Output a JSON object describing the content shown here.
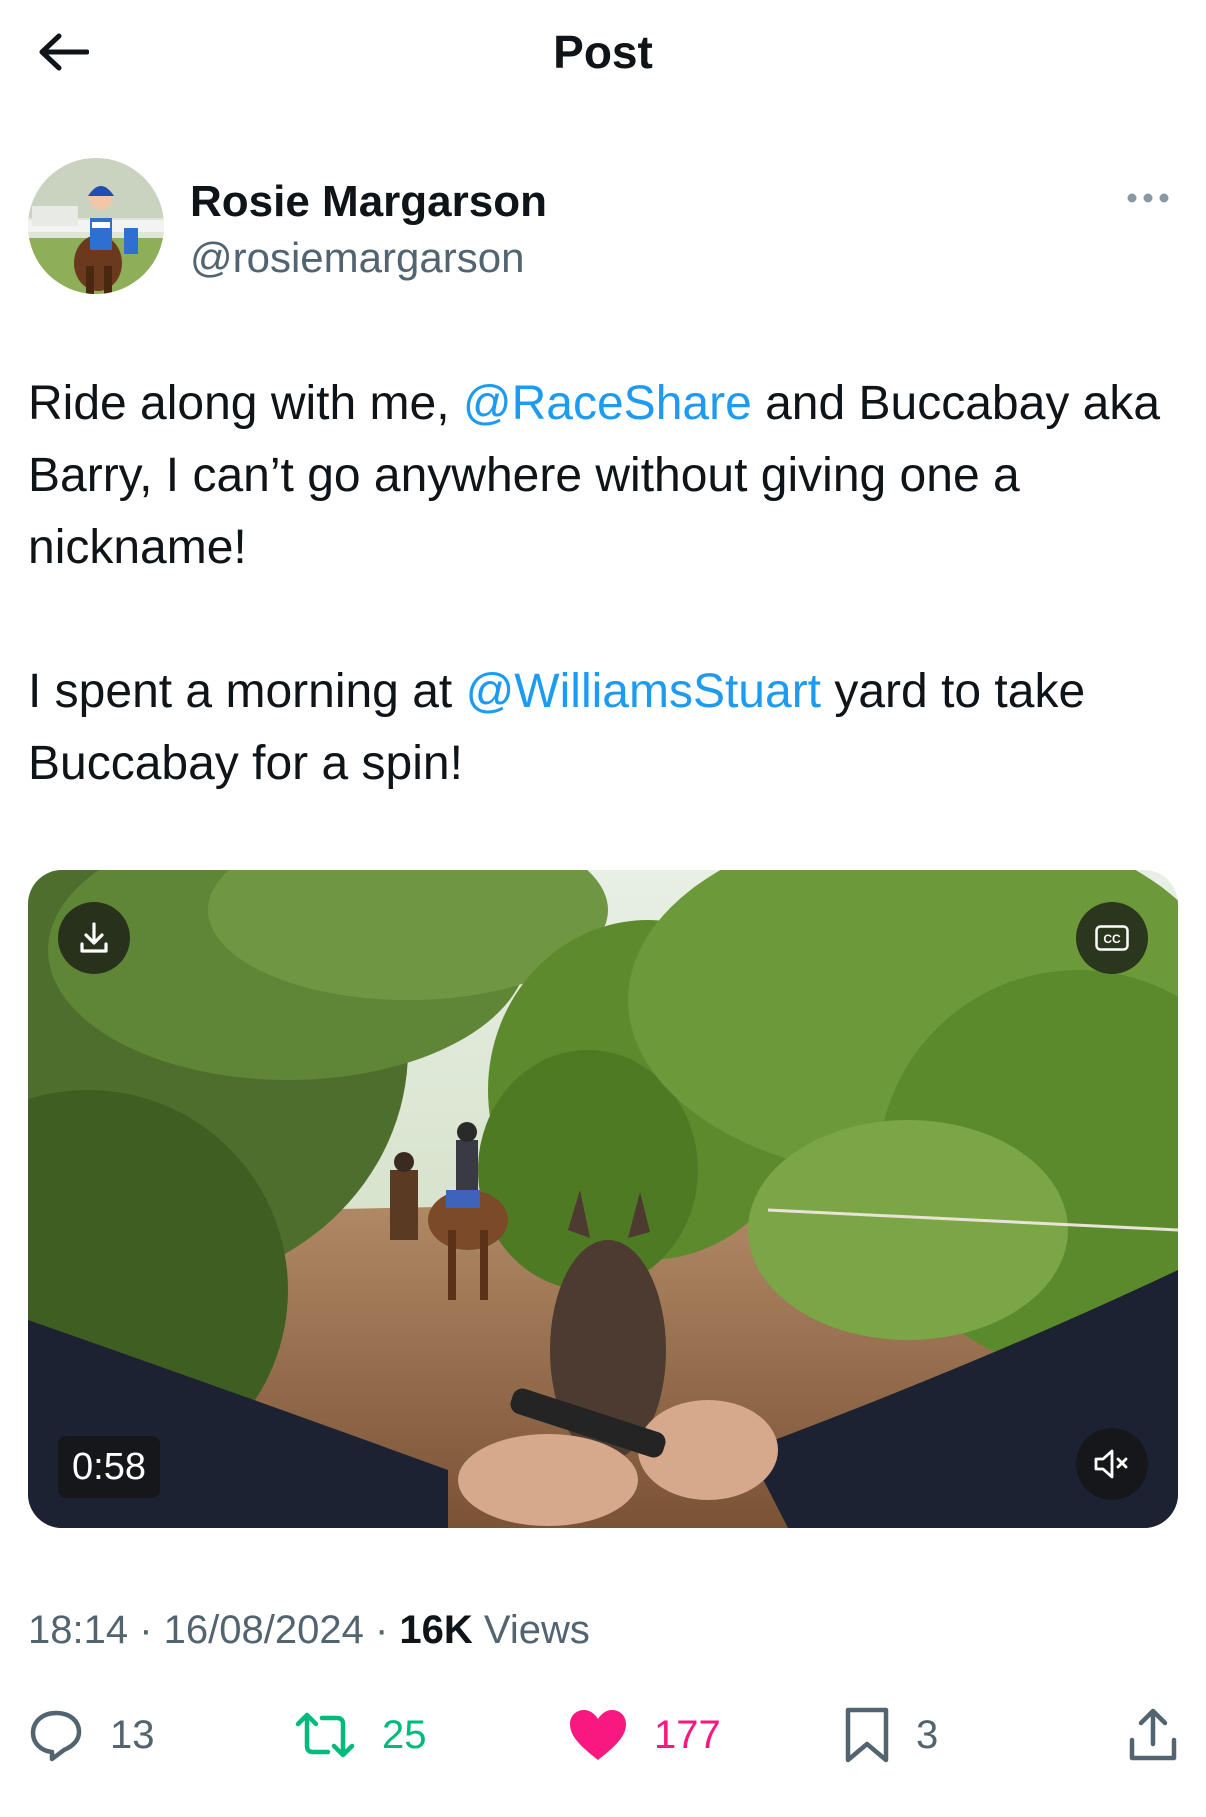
{
  "header": {
    "title": "Post",
    "back_icon": "arrow-left-icon"
  },
  "author": {
    "display_name": "Rosie Margarson",
    "handle": "@rosiemargarson",
    "more_icon": "more-horizontal-icon"
  },
  "tweet": {
    "paragraph1": {
      "part1": "Ride along with me, ",
      "mention1": "@RaceShare",
      "part2": " and Buccabay aka Barry, I can’t go anywhere without giving one a nickname!"
    },
    "paragraph2": {
      "part1": "I spent a morning at ",
      "mention1": "@WilliamsStuart",
      "part2": " yard to take Buccabay for a spin!"
    }
  },
  "media": {
    "duration": "0:58",
    "download_icon": "download-icon",
    "captions_label": "CC",
    "mute_icon": "speaker-muted-icon"
  },
  "meta": {
    "time": "18:14",
    "sep1": " · ",
    "date": "16/08/2024",
    "sep2": " · ",
    "views_count": "16K",
    "views_label": " Views"
  },
  "actions": {
    "replies": "13",
    "reposts": "25",
    "likes": "177",
    "bookmarks": "3"
  },
  "colors": {
    "link": "#1d9bf0",
    "secondary_text": "#536471",
    "repost_green": "#00ba7c",
    "like_pink": "#f91880"
  }
}
